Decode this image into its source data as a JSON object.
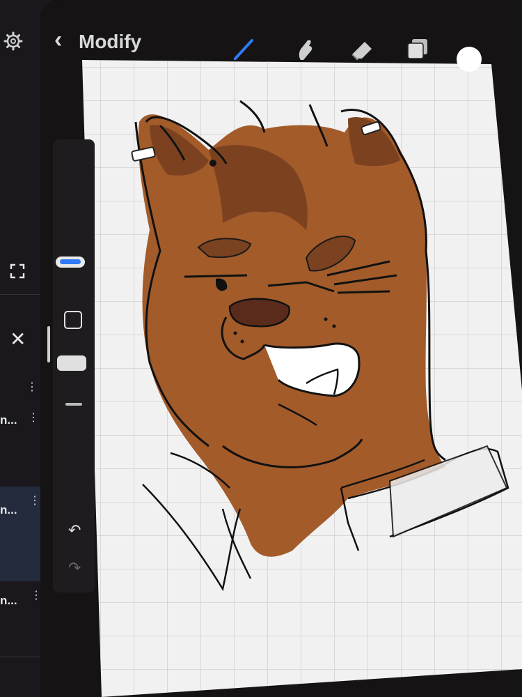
{
  "app": {
    "title": "Modify",
    "back_glyph": "‹"
  },
  "toolbar": {
    "tools": [
      {
        "name": "brush-icon",
        "active": true
      },
      {
        "name": "smudge-icon",
        "active": false
      },
      {
        "name": "eraser-icon",
        "active": false
      },
      {
        "name": "layers-icon",
        "active": false
      },
      {
        "name": "color-swatch-icon",
        "active": false
      }
    ],
    "accent": "#2f7bf5"
  },
  "layers_panel": {
    "close_glyph": "✕",
    "items": [
      {
        "label": "n..."
      },
      {
        "label": "n..."
      },
      {
        "label": "n..."
      }
    ]
  },
  "colors": {
    "fur": "#a05a2c",
    "fur_dark": "#7a4220",
    "paper": "#f2f2f2",
    "grid": "#c9c9c9",
    "nose": "#5a2b1b"
  }
}
